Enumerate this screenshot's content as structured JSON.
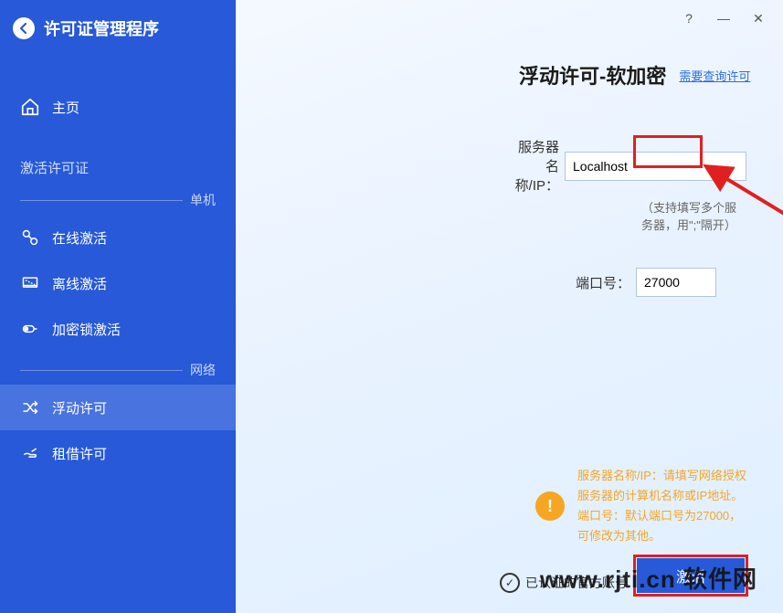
{
  "app": {
    "title": "许可证管理程序"
  },
  "titlebar": {
    "help": "?",
    "minimize": "—",
    "close": "✕"
  },
  "sidebar": {
    "home": "主页",
    "section_activate": "激活许可证",
    "divider_standalone": "单机",
    "items_standalone": [
      {
        "label": "在线激活"
      },
      {
        "label": "离线激活"
      },
      {
        "label": "加密锁激活"
      }
    ],
    "divider_network": "网络",
    "items_network": [
      {
        "label": "浮动许可"
      },
      {
        "label": "租借许可"
      }
    ]
  },
  "page": {
    "title": "浮动许可-软加密",
    "query_link": "需要查询许可"
  },
  "form": {
    "server_label": "服务器名称/IP：",
    "server_value": "Localhost",
    "server_hint": "（支持填写多个服务器，用\";\"隔开）",
    "port_label": "端口号：",
    "port_value": "27000"
  },
  "info": {
    "icon": "!",
    "line1": "服务器名称/IP：请填写网络授权服务器的计算机名称或IP地址。",
    "line2": "端口号：默认端口号为27000，可修改为其他。"
  },
  "actions": {
    "activate": "激活"
  },
  "watermark": {
    "text": "www.rjti.cn 软件网",
    "wechat": "已认证的官方账号"
  }
}
